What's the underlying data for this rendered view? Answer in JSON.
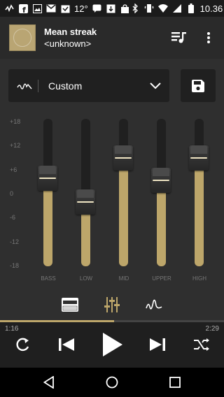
{
  "status_bar": {
    "temperature": "12°",
    "time": "10.36"
  },
  "now_playing": {
    "title": "Mean streak",
    "artist": "<unknown>"
  },
  "equalizer": {
    "preset_name": "Custom",
    "scale": [
      "+18",
      "+12",
      "+6",
      "0",
      "-6",
      "-12",
      "-18"
    ],
    "bands": [
      {
        "label": "BASS",
        "gain_db": 3.5
      },
      {
        "label": "LOW",
        "gain_db": -2.5
      },
      {
        "label": "MID",
        "gain_db": 8.5
      },
      {
        "label": "UPPER",
        "gain_db": 3.0
      },
      {
        "label": "HIGH",
        "gain_db": 8.5
      }
    ],
    "modes": [
      "amp-icon",
      "sliders-icon",
      "waveform-icon"
    ]
  },
  "player": {
    "elapsed": "1:16",
    "duration": "2:29",
    "progress_fraction": 0.51
  },
  "colors": {
    "accent": "#bda66a",
    "panel": "#2f2f2f"
  }
}
